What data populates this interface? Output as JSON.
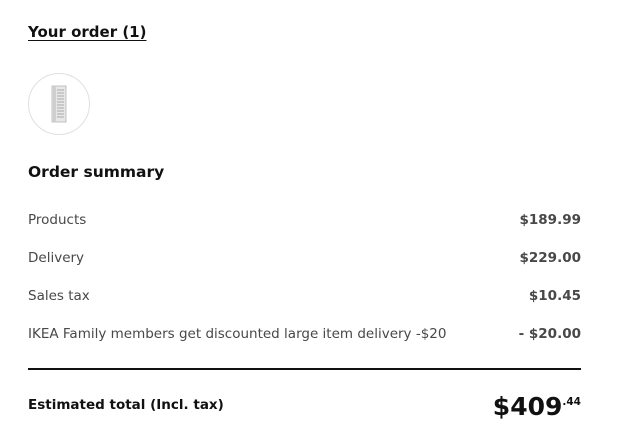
{
  "order": {
    "link_label": "Your order (1)",
    "product_thumbnail_icon": "narrow-drawer-unit-icon"
  },
  "summary": {
    "title": "Order summary",
    "rows": [
      {
        "label": "Products",
        "value": "$189.99"
      },
      {
        "label": "Delivery",
        "value": "$229.00"
      },
      {
        "label": "Sales tax",
        "value": "$10.45"
      },
      {
        "label": "IKEA Family members get discounted large item delivery -$20",
        "value": "- $20.00"
      }
    ]
  },
  "total": {
    "label": "Estimated total (Incl. tax)",
    "price_main": "$409",
    "price_cents": ".44"
  },
  "colors": {
    "text_primary": "#111111",
    "text_secondary": "#484848",
    "thumb_border": "#dfdfdf"
  }
}
